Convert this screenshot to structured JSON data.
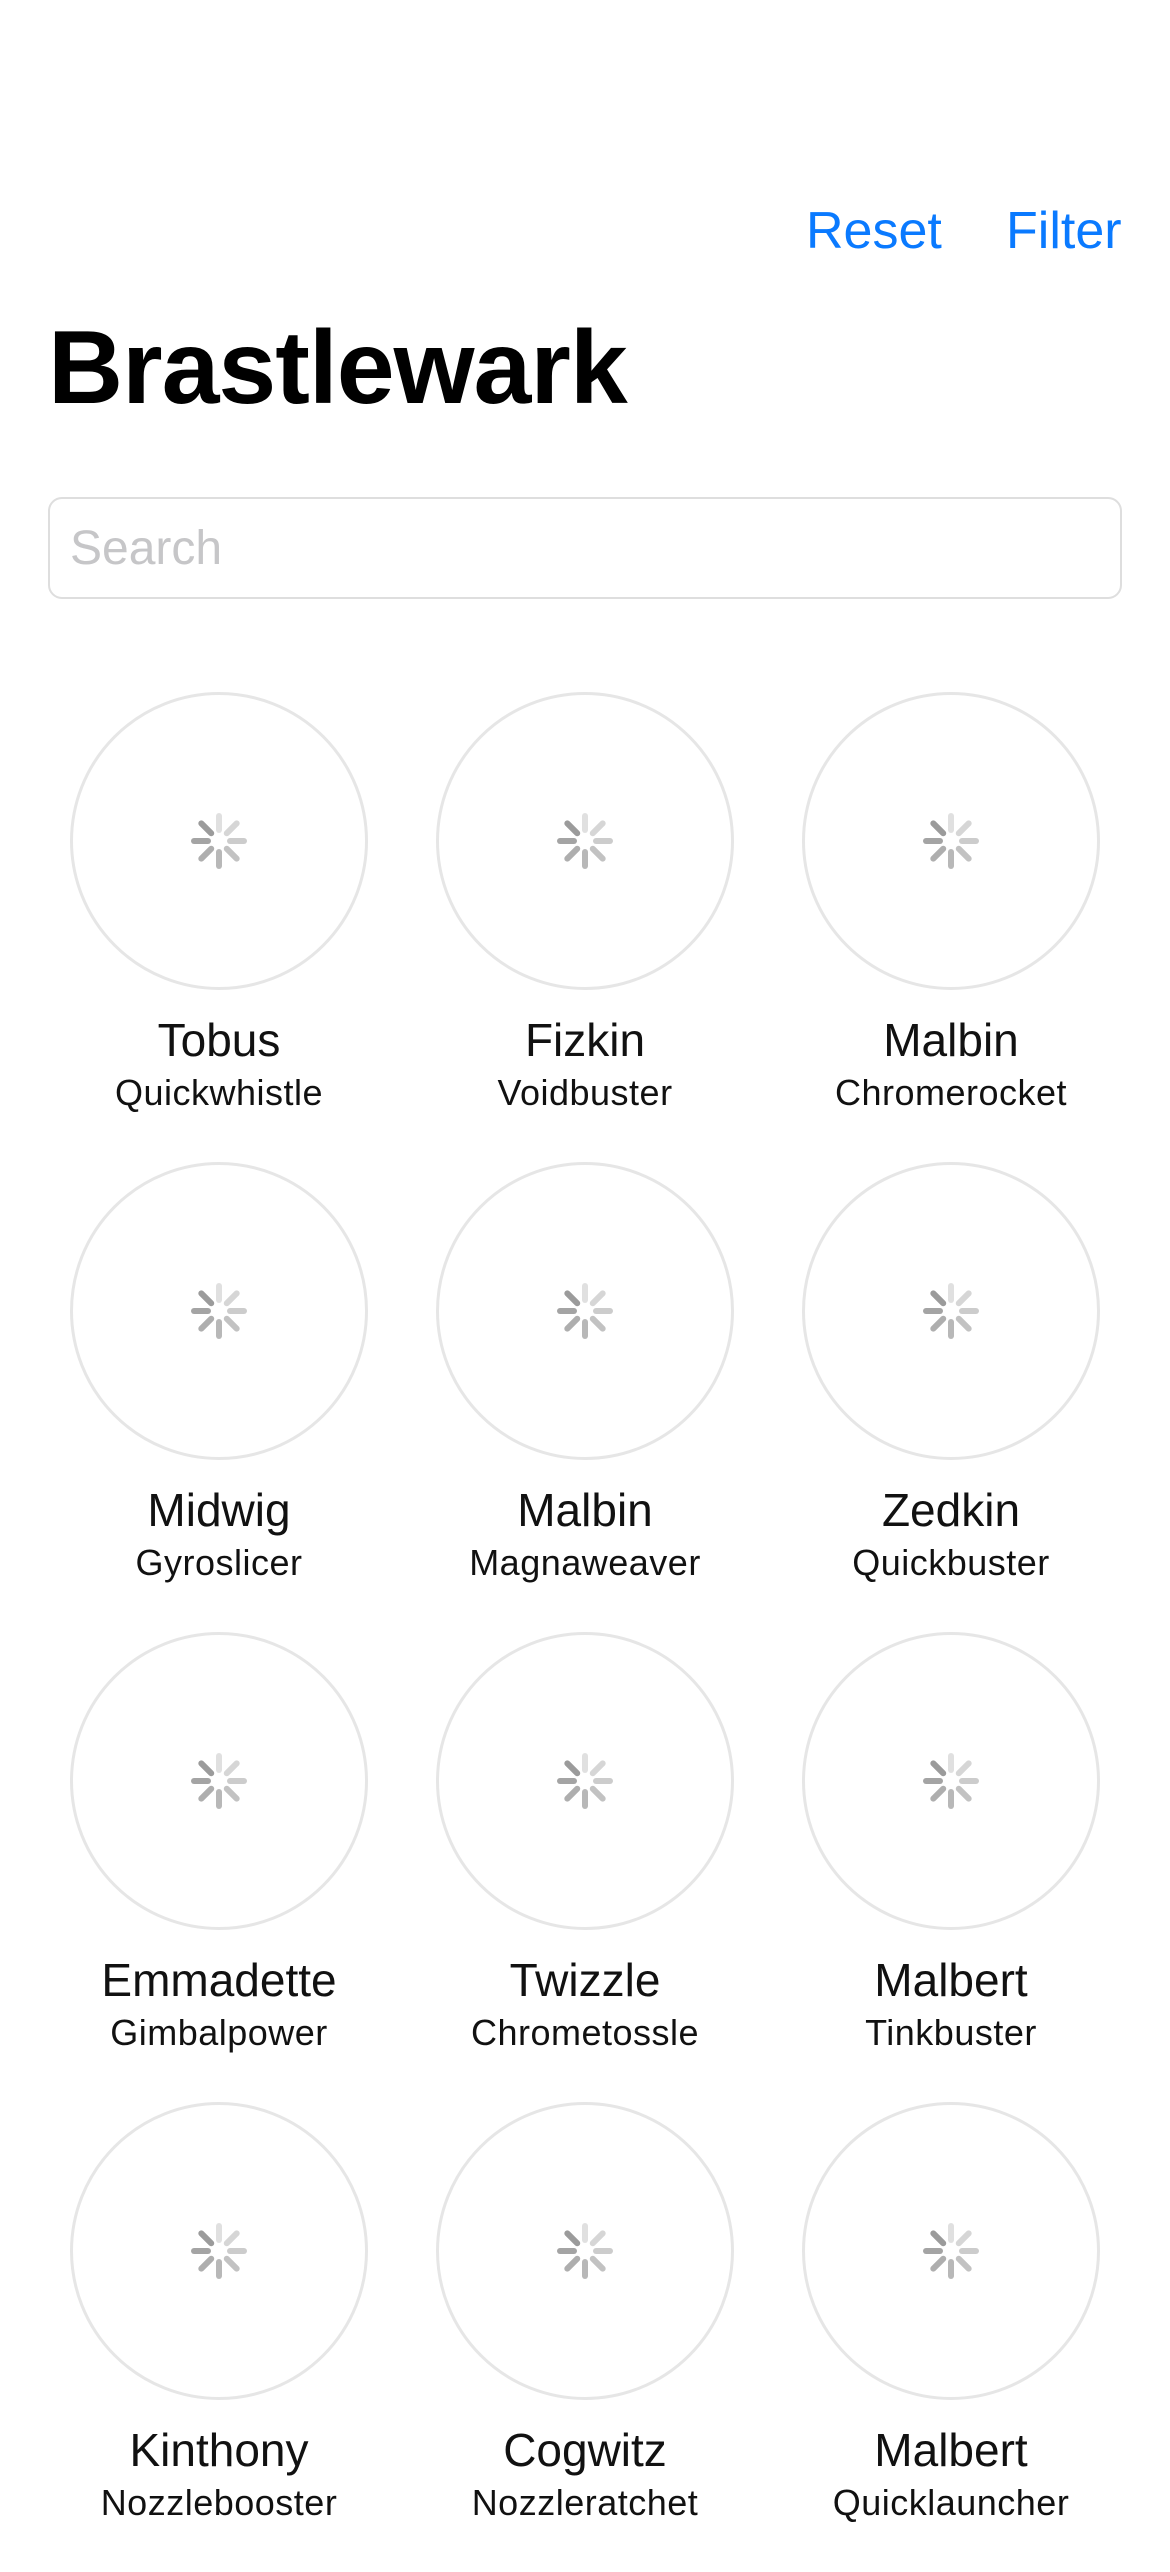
{
  "nav": {
    "reset_label": "Reset",
    "filter_label": "Filter"
  },
  "title": "Brastlewark",
  "search": {
    "placeholder": "Search",
    "value": ""
  },
  "people": [
    {
      "first": "Tobus",
      "last": "Quickwhistle"
    },
    {
      "first": "Fizkin",
      "last": "Voidbuster"
    },
    {
      "first": "Malbin",
      "last": "Chromerocket"
    },
    {
      "first": "Midwig",
      "last": "Gyroslicer"
    },
    {
      "first": "Malbin",
      "last": "Magnaweaver"
    },
    {
      "first": "Zedkin",
      "last": "Quickbuster"
    },
    {
      "first": "Emmadette",
      "last": "Gimbalpower"
    },
    {
      "first": "Twizzle",
      "last": "Chrometossle"
    },
    {
      "first": "Malbert",
      "last": "Tinkbuster"
    },
    {
      "first": "Kinthony",
      "last": "Nozzlebooster"
    },
    {
      "first": "Cogwitz",
      "last": "Nozzleratchet"
    },
    {
      "first": "Malbert",
      "last": "Quicklauncher"
    }
  ],
  "colors": {
    "accent": "#0a7aff",
    "spinner": "#9b9b9b"
  },
  "icons": {
    "avatar_placeholder": "loading-spinner-icon"
  }
}
